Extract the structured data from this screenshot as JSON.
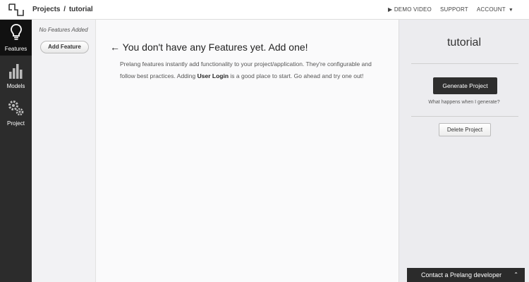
{
  "header": {
    "breadcrumb_root": "Projects",
    "breadcrumb_sep": "/",
    "breadcrumb_current": "tutorial",
    "nav": {
      "demo_video": "▶ DEMO VIDEO",
      "support": "SUPPORT",
      "account": "ACCOUNT",
      "account_caret": "▼"
    }
  },
  "sidebar": {
    "items": [
      {
        "label": "Features",
        "icon": "lightbulb-icon",
        "active": true
      },
      {
        "label": "Models",
        "icon": "bar-chart-icon",
        "active": false
      },
      {
        "label": "Project",
        "icon": "gears-icon",
        "active": false
      }
    ]
  },
  "features": {
    "empty_text": "No Features Added",
    "add_label": "Add Feature"
  },
  "main": {
    "heading": "← You don't have any Features yet.  Add one!",
    "desc_part1": "Prelang features instantly add functionality to your project/application. They're configurable and follow best practices. Adding ",
    "desc_bold": "User Login",
    "desc_part2": " is a good place to start. Go ahead and try one out!"
  },
  "panel": {
    "title": "tutorial",
    "generate_label": "Generate Project",
    "what_happens": "What happens when I generate?",
    "delete_label": "Delete Project"
  },
  "contact": {
    "label": "Contact a Prelang developer",
    "chevron": "⌃"
  },
  "colors": {
    "nav_bg": "#2c2c2c",
    "nav_active": "#111111",
    "button_dark": "#2e2e2e"
  }
}
